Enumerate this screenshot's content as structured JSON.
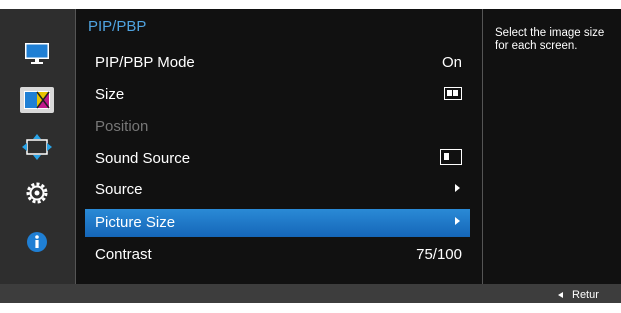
{
  "menu": {
    "title": "PIP/PBP",
    "items": [
      {
        "label": "PIP/PBP Mode",
        "value": "On"
      },
      {
        "label": "Size"
      },
      {
        "label": "Position"
      },
      {
        "label": "Sound Source"
      },
      {
        "label": "Source"
      },
      {
        "label": "Picture Size"
      },
      {
        "label": "Contrast",
        "value": "75/100"
      }
    ],
    "selected_index": 5,
    "disabled_index": 2
  },
  "help": {
    "text": "Select the image size for each screen."
  },
  "footer": {
    "return_label": "Retur"
  },
  "sidebar": {
    "icons": [
      "picture-icon",
      "color-icon",
      "size-position-icon",
      "system-icon",
      "information-icon"
    ],
    "active_index": 1
  },
  "colors": {
    "accent": "#2a8ad6",
    "title": "#4fa3e0",
    "panel": "#111111",
    "frame": "#3d3d3d"
  }
}
